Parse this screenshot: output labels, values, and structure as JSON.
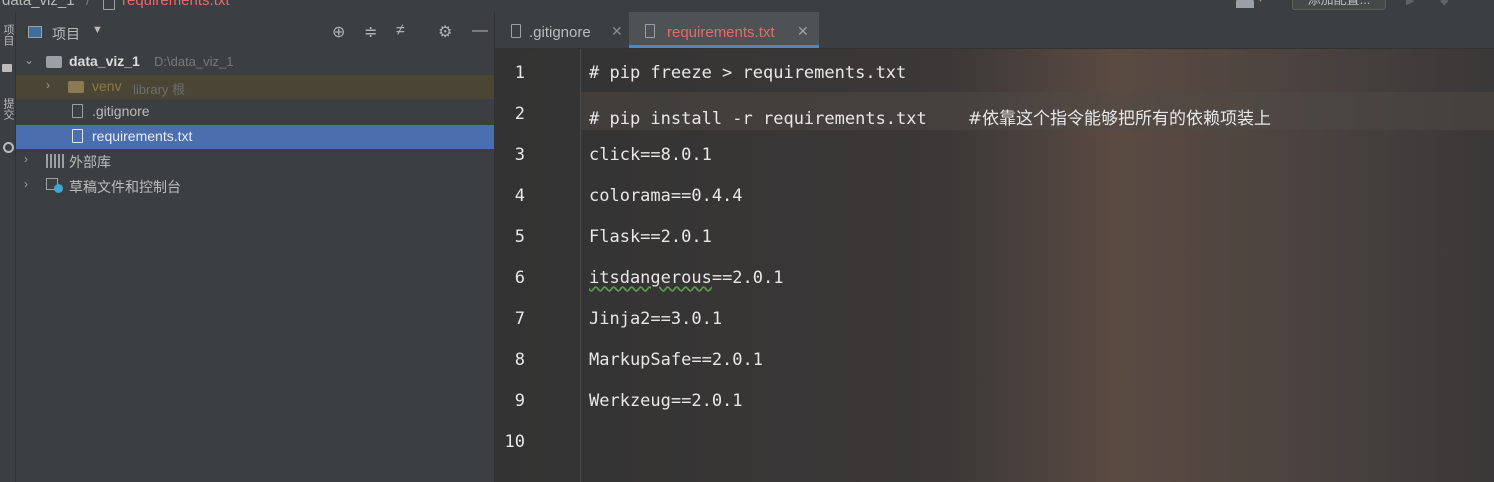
{
  "breadcrumb": {
    "project": "data_viz_1",
    "separator": "/",
    "file": "requirements.txt"
  },
  "top_toolbar": {
    "config_button": "添加配置..."
  },
  "tool_strip": {
    "project_tab": "项目",
    "commit_tab": "提交"
  },
  "project_panel": {
    "title": "项目",
    "tree": {
      "root": {
        "name": "data_viz_1",
        "path": "D:\\data_viz_1"
      },
      "venv": {
        "name": "venv",
        "hint": "library 根"
      },
      "gitignore": ".gitignore",
      "requirements": "requirements.txt",
      "external_libs": "外部库",
      "scratches": "草稿文件和控制台"
    }
  },
  "tabs": [
    {
      "label": ".gitignore",
      "active": false
    },
    {
      "label": "requirements.txt",
      "active": true
    }
  ],
  "editor": {
    "current_line": 2,
    "lines": [
      {
        "num": "1",
        "text": "# pip freeze > requirements.txt"
      },
      {
        "num": "2",
        "text": "# pip install -r requirements.txt    ",
        "comment": "#依靠这个指令能够把所有的依赖项装上"
      },
      {
        "num": "3",
        "text": "click==8.0.1"
      },
      {
        "num": "4",
        "text": "colorama==0.4.4"
      },
      {
        "num": "5",
        "text": "Flask==2.0.1"
      },
      {
        "num": "6",
        "pkg": "itsdangerous",
        "rest": "==2.0.1"
      },
      {
        "num": "7",
        "text": "Jinja2==3.0.1"
      },
      {
        "num": "8",
        "text": "MarkupSafe==2.0.1"
      },
      {
        "num": "9",
        "text": "Werkzeug==2.0.1"
      },
      {
        "num": "10",
        "text": ""
      }
    ]
  },
  "colors": {
    "accent": "#4a88c7",
    "selection": "#4b6eaf",
    "modified_file": "#e06c6c"
  }
}
